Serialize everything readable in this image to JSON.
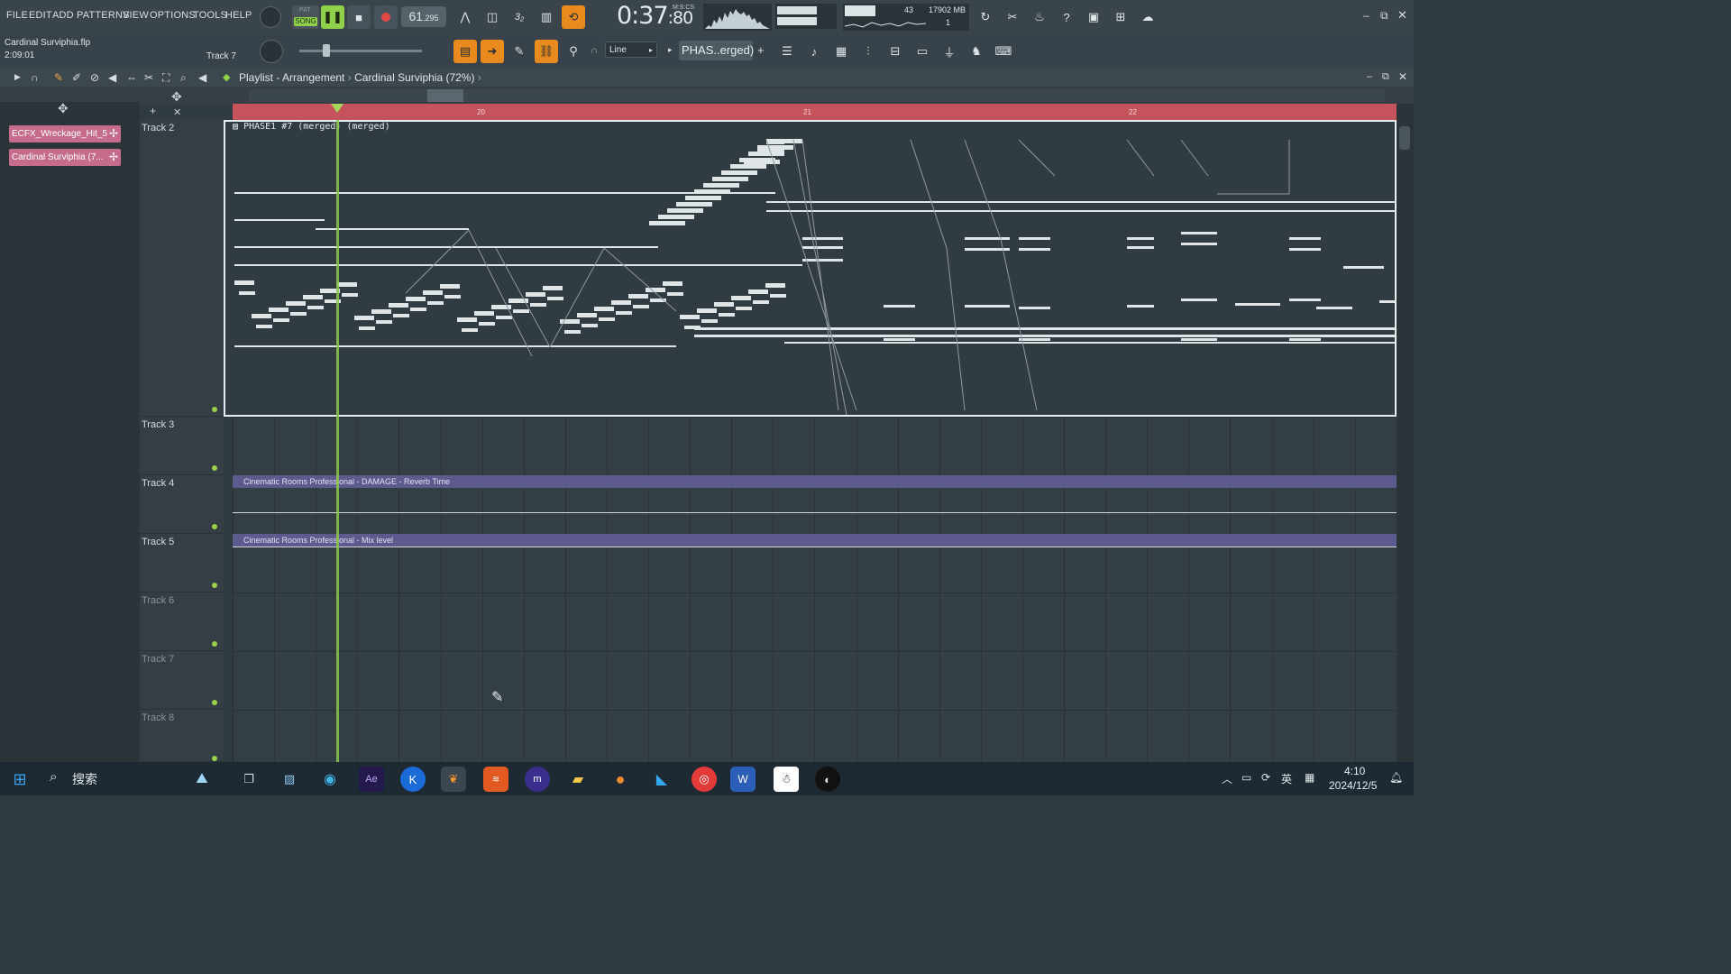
{
  "menu": [
    "FILE",
    "EDIT",
    "ADD",
    "PATTERNS",
    "VIEW",
    "OPTIONS",
    "TOOLS",
    "HELP"
  ],
  "transport": {
    "pat_label": "PAT",
    "song_label": "SONG",
    "tempo_int": "61",
    "tempo_dec": ".295",
    "time_main": "0:37",
    "time_cs": ":80",
    "time_unit": "M:S:CS",
    "cpu": "43",
    "memory": "17902 MB",
    "poly": "1"
  },
  "project": {
    "name": "Cardinal Surviphia.flp",
    "time": "2:09:01",
    "hint_track": "Track 7"
  },
  "toolbar2": {
    "snap": "Line",
    "pattern": "PHAS..erged)"
  },
  "playlist": {
    "title": "Playlist - Arrangement",
    "separator": "›",
    "project_zoom": "Cardinal Surviphia (72%)",
    "bars": [
      {
        "label": "20",
        "pos": 0.21
      },
      {
        "label": "21",
        "pos": 0.49
      },
      {
        "label": "22",
        "pos": 0.77
      }
    ],
    "picker": [
      {
        "label": "ECFX_Wreckage_Hit_5"
      },
      {
        "label": "Cardinal Surviphia (7..."
      }
    ],
    "tracks": [
      {
        "label": "Track 2",
        "dim": false
      },
      {
        "label": "Track 3",
        "dim": false
      },
      {
        "label": "Track 4",
        "dim": false
      },
      {
        "label": "Track 5",
        "dim": false
      },
      {
        "label": "Track 6",
        "dim": true
      },
      {
        "label": "Track 7",
        "dim": true
      },
      {
        "label": "Track 8",
        "dim": true
      }
    ],
    "clips": {
      "main": "PHASE1 #7 (merged) (merged)",
      "auto1": "Cinematic Rooms Professional - DAMAGE - Reverb Time",
      "auto2": "Cinematic Rooms Professional - Mix level"
    }
  },
  "taskbar": {
    "search": "搜索",
    "time": "4:10",
    "date": "2024/12/5",
    "lang": "英"
  },
  "colors": {
    "accent": "#e98a1f",
    "song": "#8fd14a",
    "ruler": "#c5535c",
    "clip": "#c56c8d",
    "automation": "#5d5a8e",
    "playhead": "#8cc84b"
  }
}
